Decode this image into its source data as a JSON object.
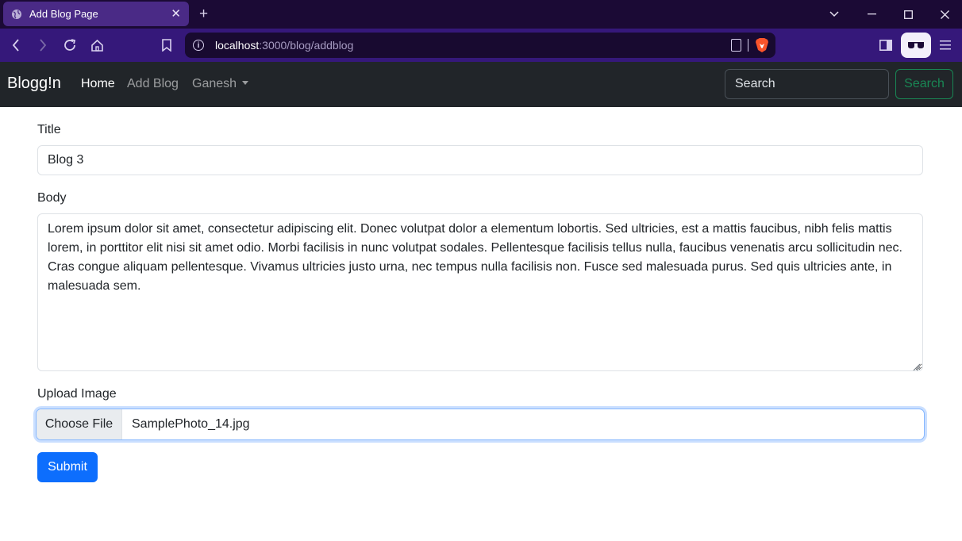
{
  "browser": {
    "tab_title": "Add Blog Page",
    "url_host": "localhost",
    "url_path": ":3000/blog/addblog"
  },
  "navbar": {
    "brand": "Blogg!n",
    "links": [
      "Home",
      "Add Blog",
      "Ganesh"
    ],
    "search_placeholder": "Search",
    "search_button": "Search"
  },
  "form": {
    "title_label": "Title",
    "title_value": "Blog 3",
    "body_label": "Body",
    "body_value": "Lorem ipsum dolor sit amet, consectetur adipiscing elit. Donec volutpat dolor a elementum lobortis. Sed ultricies, est a mattis faucibus, nibh felis mattis lorem, in porttitor elit nisi sit amet odio. Morbi facilisis in nunc volutpat sodales. Pellentesque facilisis tellus nulla, faucibus venenatis arcu sollicitudin nec. Cras congue aliquam pellentesque. Vivamus ultricies justo urna, nec tempus nulla facilisis non. Fusce sed malesuada purus. Sed quis ultricies ante, in malesuada sem.",
    "upload_label": "Upload Image",
    "choose_file_label": "Choose File",
    "file_name": "SamplePhoto_14.jpg",
    "submit_label": "Submit"
  },
  "colors": {
    "navbar_bg": "#212529",
    "primary": "#0d6efd",
    "success": "#198754",
    "browser_tab": "#4a2a86",
    "browser_toolbar": "#35187a"
  }
}
